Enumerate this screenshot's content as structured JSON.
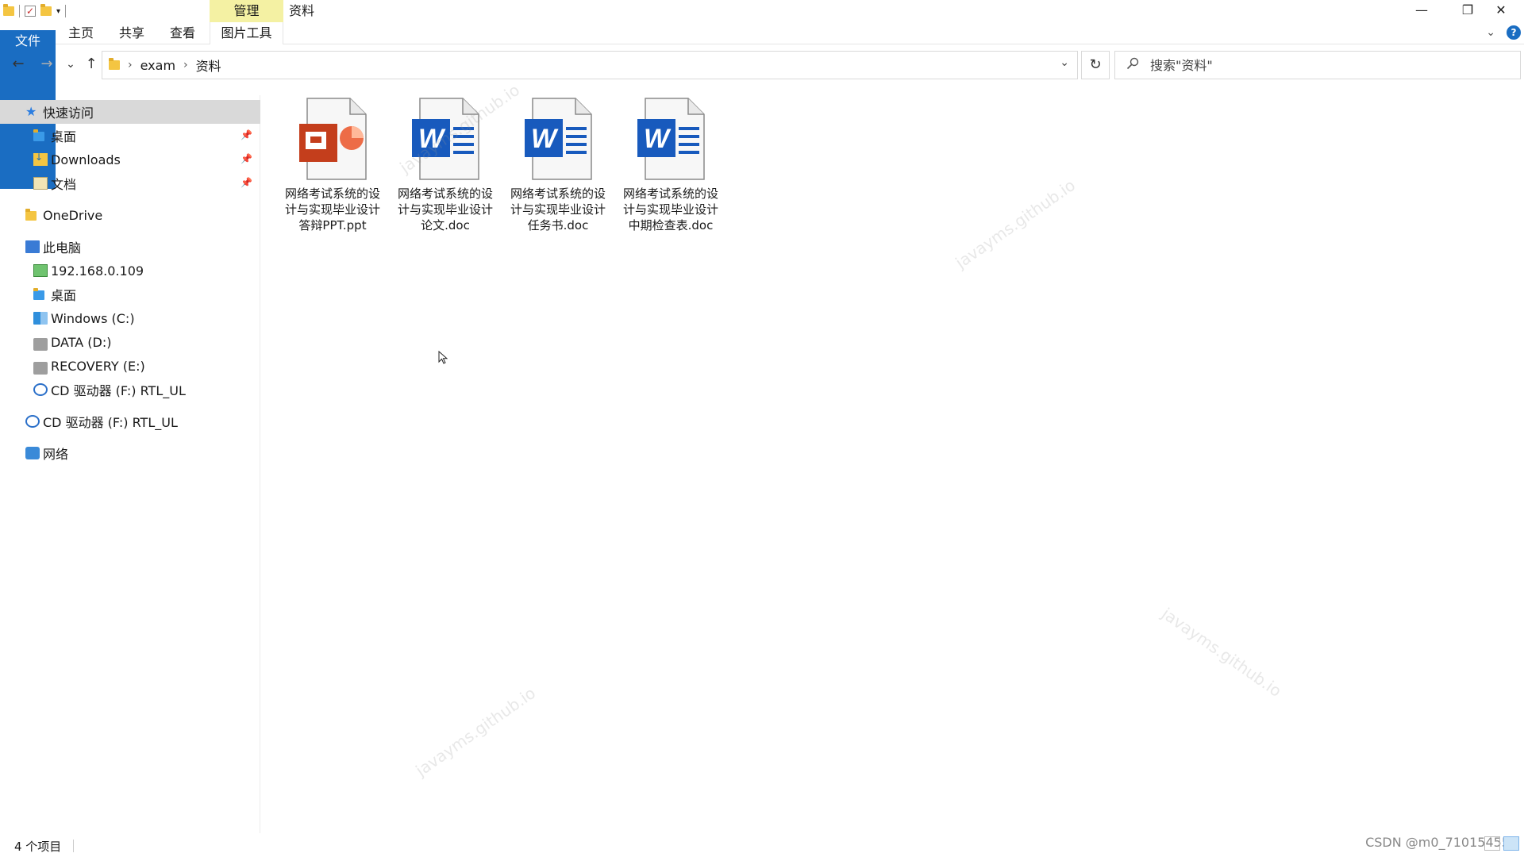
{
  "title_bar": {
    "manage_tab": "管理",
    "window_title": "资料",
    "minimize": "—",
    "restore": "❐",
    "close": "✕"
  },
  "ribbon": {
    "tabs": [
      {
        "label": "文件"
      },
      {
        "label": "主页"
      },
      {
        "label": "共享"
      },
      {
        "label": "查看"
      },
      {
        "label": "图片工具"
      }
    ],
    "help": "?"
  },
  "nav": {
    "back": "←",
    "forward": "→",
    "recent": "⌄",
    "up": "↑",
    "breadcrumb": [
      "exam",
      "资料"
    ],
    "search_placeholder": "搜索\"资料\""
  },
  "nav_pane": {
    "items": [
      {
        "label": "快速访问",
        "icon": "star-icon",
        "level": 0,
        "selected": true,
        "pinned": false
      },
      {
        "label": "桌面",
        "icon": "folder-icon",
        "level": 1,
        "pinned": true
      },
      {
        "label": "Downloads",
        "icon": "downloads-icon",
        "level": 1,
        "pinned": true
      },
      {
        "label": "文档",
        "icon": "documents-icon",
        "level": 1,
        "pinned": true
      },
      {
        "label": "OneDrive",
        "icon": "folder-icon",
        "level": 0
      },
      {
        "label": "此电脑",
        "icon": "pc-icon",
        "level": 0
      },
      {
        "label": "192.168.0.109",
        "icon": "network-drive-icon",
        "level": 1
      },
      {
        "label": "桌面",
        "icon": "folder-icon",
        "level": 1
      },
      {
        "label": "Windows (C:)",
        "icon": "windows-drive-icon",
        "level": 1
      },
      {
        "label": "DATA (D:)",
        "icon": "drive-icon",
        "level": 1
      },
      {
        "label": "RECOVERY (E:)",
        "icon": "drive-icon",
        "level": 1
      },
      {
        "label": "CD 驱动器 (F:) RTL_UL",
        "icon": "cd-icon",
        "level": 1
      },
      {
        "label": "CD 驱动器 (F:) RTL_UL",
        "icon": "cd-icon",
        "level": 0
      },
      {
        "label": "网络",
        "icon": "network-icon",
        "level": 0
      }
    ]
  },
  "files": [
    {
      "name": "网络考试系统的设计与实现毕业设计答辩PPT.ppt",
      "type": "ppt"
    },
    {
      "name": "网络考试系统的设计与实现毕业设计论文.doc",
      "type": "doc"
    },
    {
      "name": "网络考试系统的设计与实现毕业设计任务书.doc",
      "type": "doc"
    },
    {
      "name": "网络考试系统的设计与实现毕业设计中期检查表.doc",
      "type": "doc"
    }
  ],
  "watermark_text": "javayms.github.io",
  "status": {
    "item_count": "4 个项目"
  },
  "overlay": {
    "csdn": "CSDN @m0_71015455"
  },
  "colors": {
    "file_tab": "#1a6dc2",
    "manage_tab": "#f4f1a3",
    "selected_nav": "#d9d9d9",
    "ppt_red": "#c43e1c",
    "word_blue": "#185abd"
  }
}
